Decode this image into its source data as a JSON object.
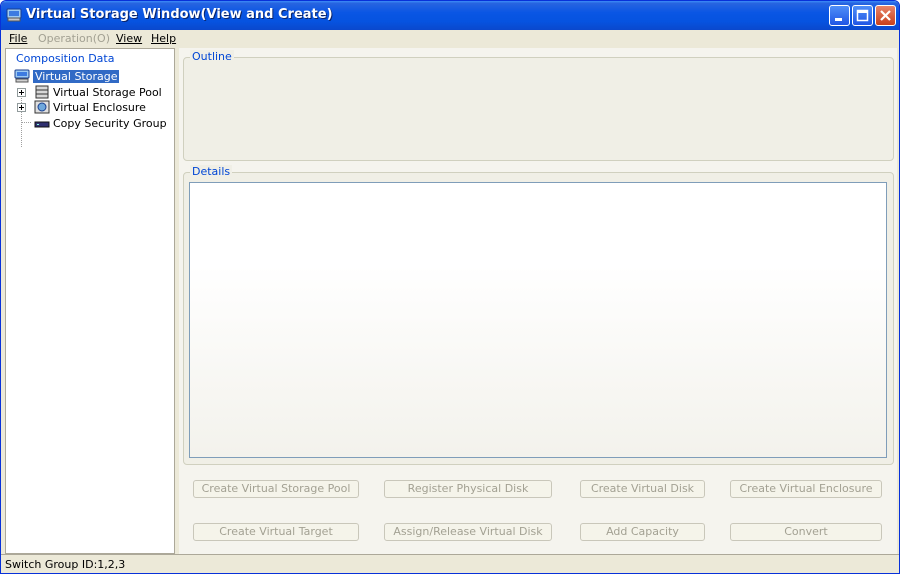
{
  "window": {
    "title": "Virtual Storage Window(View and Create)"
  },
  "menu": {
    "file": "File",
    "operation": "Operation(O)",
    "view": "View",
    "help": "Help"
  },
  "left_panel": {
    "caption": "Composition Data",
    "tree": {
      "root": "Virtual Storage",
      "items": [
        {
          "label": "Virtual Storage Pool",
          "icon": "storage-pool-icon",
          "expandable": true
        },
        {
          "label": "Virtual Enclosure",
          "icon": "enclosure-icon",
          "expandable": true
        },
        {
          "label": "Copy Security Group",
          "icon": "security-group-icon",
          "expandable": false
        }
      ]
    }
  },
  "outline": {
    "caption": "Outline"
  },
  "details": {
    "caption": "Details"
  },
  "buttons": {
    "create_pool": "Create Virtual Storage Pool",
    "register_disk": "Register Physical Disk",
    "create_disk": "Create Virtual Disk",
    "create_enclosure": "Create Virtual Enclosure",
    "create_target": "Create Virtual Target",
    "assign_release": "Assign/Release Virtual Disk",
    "add_capacity": "Add Capacity",
    "convert": "Convert"
  },
  "status": {
    "text": "Switch Group ID:1,2,3"
  },
  "colors": {
    "title_bar": "#0a56e4",
    "selection": "#316ac5",
    "caption": "#0046d5",
    "disabled_text": "#a3a193"
  }
}
